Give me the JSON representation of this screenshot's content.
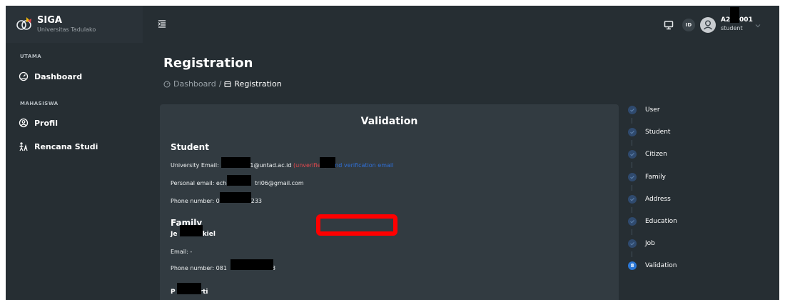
{
  "brand": {
    "name": "SIGA",
    "subtitle": "Universitas Tadulako"
  },
  "header": {
    "lang": "ID",
    "user_id": "A22  .001",
    "user_role": "student"
  },
  "sidebar": {
    "sections": [
      {
        "label": "UTAMA",
        "items": [
          {
            "label": "Dashboard",
            "icon": "dashboard-icon"
          }
        ]
      },
      {
        "label": "MAHASISWA",
        "items": [
          {
            "label": "Profil",
            "icon": "profile-icon"
          },
          {
            "label": "Rencana Studi",
            "icon": "study-plan-icon"
          }
        ]
      }
    ]
  },
  "page": {
    "title": "Registration",
    "breadcrumb": {
      "home": "Dashboard",
      "separator": "/",
      "current": "Registration"
    }
  },
  "validation": {
    "title": "Validation",
    "student": {
      "heading": "Student",
      "email_label": "University Email: a2",
      "email_rest": "01@untad.ac.id",
      "email_status": "(unverified)",
      "verify_link": "send verification email",
      "personal_label": "Personal email: echaa",
      "personal_rest": "tri06@gmail.com",
      "phone_label": "Phone number: 0",
      "phone_rest": "233"
    },
    "family": {
      "heading": "Family",
      "member1_a": "Je",
      "member1_b": "zkiel",
      "email_line": "Email: -",
      "phone_label": "Phone number: 081",
      "phone_rest": "63",
      "member2_a": "P",
      "member2_b": "arti"
    }
  },
  "stepper": {
    "steps": [
      {
        "label": "User"
      },
      {
        "label": "Student"
      },
      {
        "label": "Citizen"
      },
      {
        "label": "Family"
      },
      {
        "label": "Address"
      },
      {
        "label": "Education"
      },
      {
        "label": "Job"
      },
      {
        "label": "Validation",
        "number": "8"
      }
    ]
  },
  "colors": {
    "bg": "#262e33",
    "card": "#323b41",
    "accent": "#2b77d5",
    "link": "#2f6fd6",
    "error": "#e5484d",
    "highlight": "#ff0000"
  }
}
